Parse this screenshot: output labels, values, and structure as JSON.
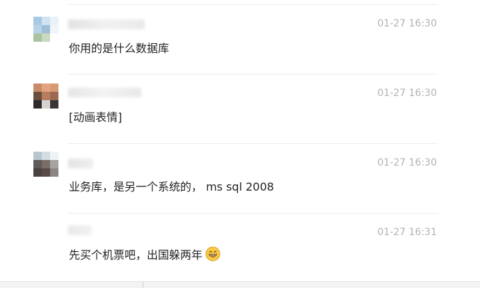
{
  "messages": [
    {
      "time": "01-27 16:30",
      "text": "你用的是什么数据库"
    },
    {
      "time": "01-27 16:30",
      "text": "[动画表情]"
    },
    {
      "time": "01-27 16:30",
      "text": "业务库，是另一个系统的， ms sql 2008"
    },
    {
      "time": "01-27 16:31",
      "text": "先买个机票吧，出国躲两年",
      "emoji": "grinning-face-icon"
    }
  ],
  "colors": {
    "time": "#b2b2b2",
    "text": "#222222",
    "divider": "#ececec"
  }
}
